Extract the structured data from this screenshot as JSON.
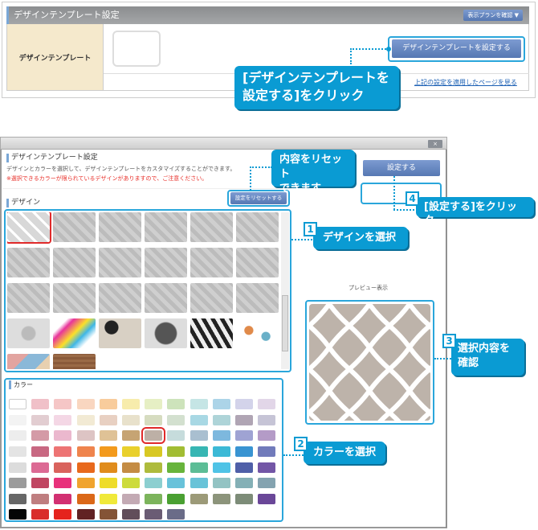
{
  "top_panel": {
    "title": "デザインテンプレート設定",
    "plan_button": "表示プランを確認 ▼",
    "row_label": "デザインテンプレート",
    "set_template_button": "デザインテンプレートを設定する",
    "apply_link": "上記の設定を適用したページを見る"
  },
  "callouts": {
    "set_template": "[デザインテンプレートを\n設定する]をクリック",
    "reset": "内容をリセット\nできます",
    "step1": {
      "num": "1",
      "text": "デザインを選択"
    },
    "step2": {
      "num": "2",
      "text": "カラーを選択"
    },
    "step3": {
      "num": "3",
      "text": "選択内容を\n確認"
    },
    "step4": {
      "num": "4",
      "text": "[設定する]をクリック"
    }
  },
  "dialog": {
    "close_label": "×",
    "title": "デザインテンプレート設定",
    "description": "デザインとカラーを選択して、デザインテンプレートをカスタマイズすることができます。",
    "warning": "※選択できるカラーが限られているデザインがありますので、ご注意ください。",
    "reset_button": "設定をリセットする",
    "submit_button": "設定する",
    "design_label": "デザイン",
    "color_label": "カラー",
    "preview_label": "プレビュー表示",
    "selected_design": 0,
    "selected_color": [
      2,
      6
    ],
    "designs": [
      "moroccan-lattice",
      "doodle",
      "shells",
      "branches",
      "dots",
      "floral",
      "flower-silhouette",
      "stripes",
      "medallion",
      "tile-pattern",
      "squares",
      "polka-dots",
      "scallop",
      "circles",
      "plaid",
      "gingham",
      "scissors",
      "lattice",
      "splash",
      "paint-splash",
      "leopard",
      "giraffe",
      "zebra",
      "leaves",
      "triangles",
      "wood"
    ],
    "colors": [
      [
        "#ffffff",
        "#f0c0c8",
        "#f5c6c6",
        "#f9d6c0",
        "#f8cc9c",
        "#f7ecac",
        "#e6efc4",
        "#cde3bb",
        "#c5e5e5",
        "#acd4e8",
        "#d3d3ea",
        "#e2d6e8"
      ],
      [
        "#f3f3f3",
        "#e2cdd1",
        "#f4d7e5",
        "#f2ead4",
        "#e8d0c2",
        "#e8e1cb",
        "#d6dcc0",
        "#d3e0cf",
        "#a8d8e4",
        "#aed4d8",
        "#b0a5b4",
        "#c6c4d6"
      ],
      [
        "#ededed",
        "#d49aa6",
        "#ebb8ce",
        "#ddc4c4",
        "#dfc296",
        "#c6a473",
        "#bdb0a6",
        "#c6dcdc",
        "#a9bfd0",
        "#7db8de",
        "#9fa3d3",
        "#b49bc7"
      ],
      [
        "#e4e4e4",
        "#c86882",
        "#ed7474",
        "#ef844d",
        "#f39a1c",
        "#e9d02c",
        "#d8c823",
        "#a2bd33",
        "#37b6b3",
        "#3cb9d6",
        "#3994d2",
        "#717bbb"
      ],
      [
        "#dcdcdc",
        "#dc6a94",
        "#d9635d",
        "#e8691c",
        "#e08c1c",
        "#c48c44",
        "#aebb3c",
        "#67b43c",
        "#5cbd96",
        "#4fc3e6",
        "#4f5fa8",
        "#7356a6"
      ],
      [
        "#9b9b9b",
        "#c04662",
        "#e8317b",
        "#f0a42e",
        "#eedc2a",
        "#cddb3c",
        "#8ccfd0",
        "#68c2da",
        "#68c3d8",
        "#93c3c3",
        "#84b0b6",
        "#84a3b0"
      ],
      [
        "#676767",
        "#bf7e80",
        "#d23072",
        "#db6818",
        "#f0e93a",
        "#c3aab4",
        "#7cb45c",
        "#4aa032",
        "#9c9a78",
        "#8c947b",
        "#7d8c78",
        "#6a4798"
      ],
      [
        "#050505",
        "#d92d2a",
        "#e5231d",
        "#612223",
        "#845436",
        "#614e5a",
        "#6a5c74",
        "#6a6c88"
      ]
    ]
  },
  "accent_color": "#0a9bd3"
}
